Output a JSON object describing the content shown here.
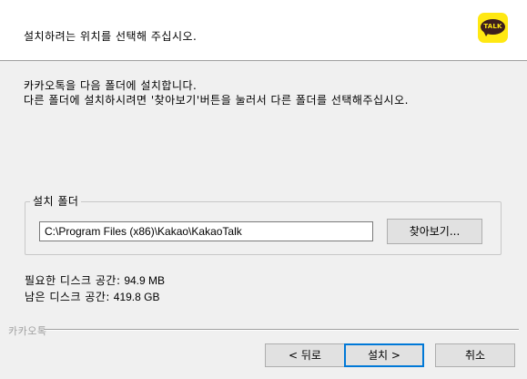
{
  "header": {
    "title": "설치하려는 위치를 선택해 주십시오.",
    "logo_text": "TALK"
  },
  "description": {
    "line1": "카카오톡을 다음 폴더에 설치합니다.",
    "line2": "다른 폴더에 설치하시려면 '찾아보기'버튼을 눌러서 다른 폴더를 선택해주십시오."
  },
  "destination": {
    "group_label": "설치 폴더",
    "path": "C:\\Program Files (x86)\\Kakao\\KakaoTalk",
    "browse_label": "찾아보기..."
  },
  "space": {
    "required_label": "필요한 디스크 공간:",
    "required_value": "94.9 MB",
    "available_label": "남은 디스크 공간:",
    "available_value": "419.8 GB"
  },
  "footer": {
    "brand": "카카오톡",
    "back_label": "< 뒤로",
    "next_label": "설치 >",
    "cancel_label": "취소"
  }
}
